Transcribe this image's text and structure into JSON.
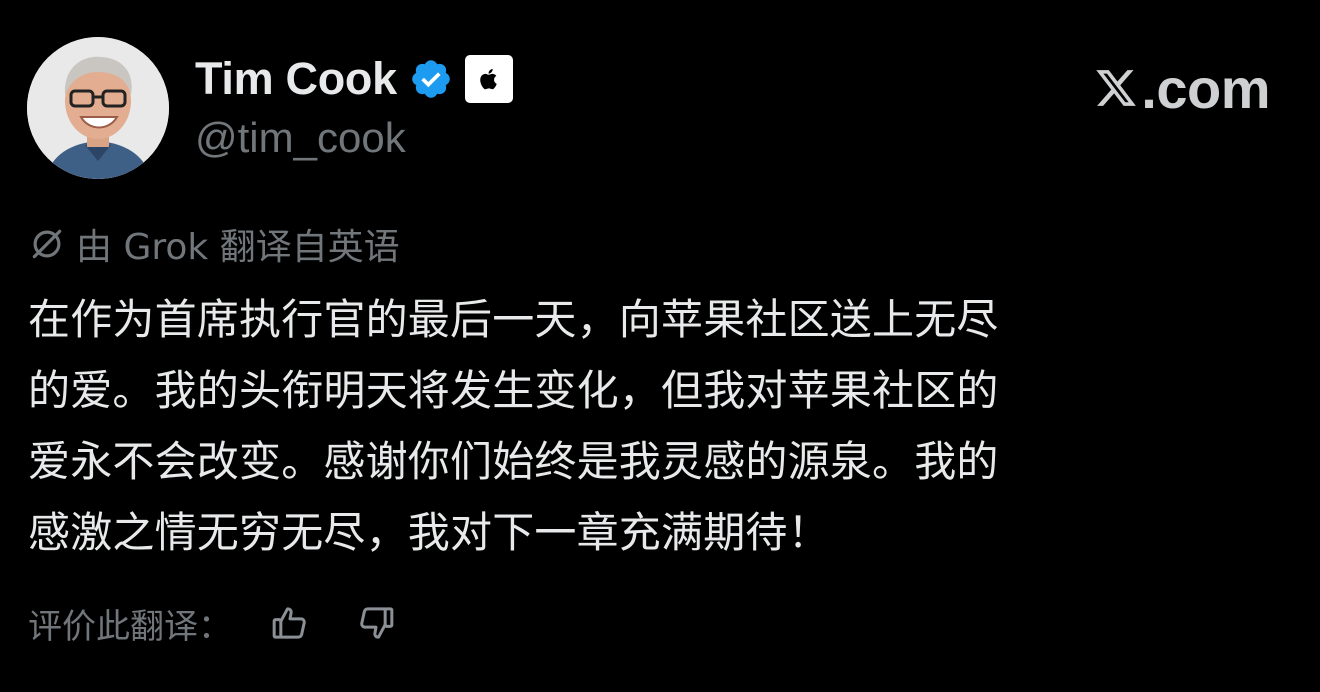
{
  "author": {
    "display_name": "Tim Cook",
    "handle": "@tim_cook",
    "avatar_icon": "profile-photo",
    "verified_icon": "verified-check-icon",
    "affiliate_icon": "apple-logo-icon"
  },
  "brand": {
    "text": ".com",
    "logo_icon": "x-logo-icon"
  },
  "translation": {
    "note": "由 Grok 翻译自英语",
    "icon": "grok-icon"
  },
  "post": {
    "lines": [
      "在作为首席执行官的最后一天，向苹果社区送上无尽",
      "的爱。我的头衔明天将发生变化，但我对苹果社区的",
      "爱永不会改变。感谢你们始终是我灵感的源泉。我的",
      "感激之情无穷无尽，我对下一章充满期待！"
    ]
  },
  "rating": {
    "label": "评价此翻译：",
    "up_icon": "thumbs-up-icon",
    "down_icon": "thumbs-down-icon"
  },
  "colors": {
    "background": "#000000",
    "text_primary": "#e7e9ea",
    "text_secondary": "#71767b",
    "verified_blue": "#1d9bf0"
  }
}
